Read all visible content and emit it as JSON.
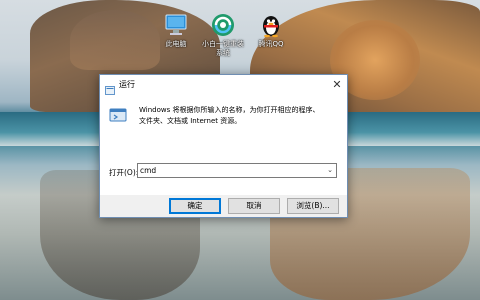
{
  "desktop": {
    "icons": [
      {
        "label": "此电脑",
        "icon": "computer-icon"
      },
      {
        "label": "小白一键重装系统",
        "icon": "reinstall-app-icon"
      },
      {
        "label": "腾讯QQ",
        "icon": "qq-penguin-icon"
      }
    ]
  },
  "dialog": {
    "title": "运行",
    "close_label": "✕",
    "description_line1": "Windows 将根据你所输入的名称，为你打开相应的程序、",
    "description_line2": "文件夹、文档或 Internet 资源。",
    "open_label": "打开(O):",
    "open_value": "cmd",
    "buttons": {
      "ok": "确定",
      "cancel": "取消",
      "browse": "浏览(B)..."
    }
  },
  "colors": {
    "accent": "#0078d7",
    "dialog_bg": "#f0f0f0"
  }
}
